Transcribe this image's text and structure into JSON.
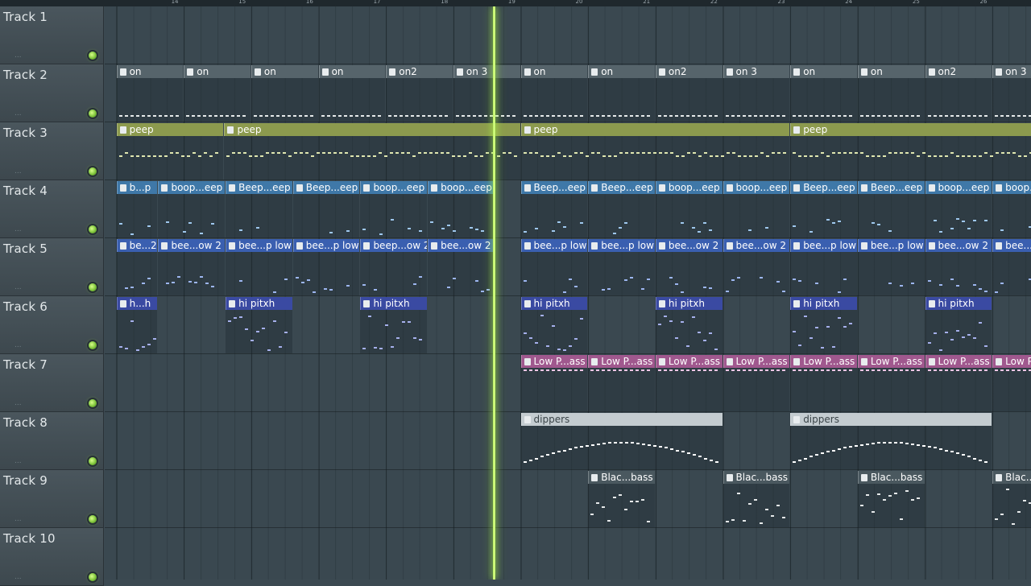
{
  "ruler": {
    "bar_numbers": [
      "14",
      "15",
      "16",
      "17",
      "18",
      "19",
      "20",
      "21",
      "22",
      "23",
      "24",
      "25",
      "26"
    ]
  },
  "tracks": [
    {
      "name": "Track 1",
      "dots": "..."
    },
    {
      "name": "Track 2",
      "dots": "..."
    },
    {
      "name": "Track 3",
      "dots": "..."
    },
    {
      "name": "Track 4",
      "dots": "..."
    },
    {
      "name": "Track 5",
      "dots": "..."
    },
    {
      "name": "Track 6",
      "dots": "..."
    },
    {
      "name": "Track 7",
      "dots": "..."
    },
    {
      "name": "Track 8",
      "dots": "..."
    },
    {
      "name": "Track 9",
      "dots": "..."
    },
    {
      "name": "Track 10",
      "dots": "..."
    }
  ],
  "clips": [
    {
      "track": 1,
      "start": 0,
      "len": 1,
      "label": "on",
      "head": "#56646b",
      "note": "#e6e9ea"
    },
    {
      "track": 1,
      "start": 1,
      "len": 1,
      "label": "on",
      "head": "#56646b",
      "note": "#e6e9ea"
    },
    {
      "track": 1,
      "start": 2,
      "len": 1,
      "label": "on",
      "head": "#56646b",
      "note": "#e6e9ea"
    },
    {
      "track": 1,
      "start": 3,
      "len": 1,
      "label": "on",
      "head": "#56646b",
      "note": "#e6e9ea"
    },
    {
      "track": 1,
      "start": 4,
      "len": 1,
      "label": "on2",
      "head": "#56646b",
      "note": "#e6e9ea"
    },
    {
      "track": 1,
      "start": 5,
      "len": 1,
      "label": "on 3",
      "head": "#56646b",
      "note": "#e6e9ea"
    },
    {
      "track": 1,
      "start": 6,
      "len": 1,
      "label": "on",
      "head": "#56646b",
      "note": "#e6e9ea"
    },
    {
      "track": 1,
      "start": 7,
      "len": 1,
      "label": "on",
      "head": "#56646b",
      "note": "#e6e9ea"
    },
    {
      "track": 1,
      "start": 8,
      "len": 1,
      "label": "on2",
      "head": "#56646b",
      "note": "#e6e9ea"
    },
    {
      "track": 1,
      "start": 9,
      "len": 1,
      "label": "on 3",
      "head": "#56646b",
      "note": "#e6e9ea"
    },
    {
      "track": 1,
      "start": 10,
      "len": 1,
      "label": "on",
      "head": "#56646b",
      "note": "#e6e9ea"
    },
    {
      "track": 1,
      "start": 11,
      "len": 1,
      "label": "on",
      "head": "#56646b",
      "note": "#e6e9ea"
    },
    {
      "track": 1,
      "start": 12,
      "len": 1,
      "label": "on2",
      "head": "#56646b",
      "note": "#e6e9ea"
    },
    {
      "track": 1,
      "start": 13,
      "len": 1,
      "label": "on 3",
      "head": "#56646b",
      "note": "#e6e9ea"
    },
    {
      "track": 2,
      "start": 0,
      "len": 1.6,
      "label": "peep",
      "head": "#8c9a4e",
      "note": "#dfe6b0"
    },
    {
      "track": 2,
      "start": 1.6,
      "len": 4.4,
      "label": "peep",
      "head": "#8c9a4e",
      "note": "#dfe6b0"
    },
    {
      "track": 2,
      "start": 6,
      "len": 4,
      "label": "peep",
      "head": "#8c9a4e",
      "note": "#dfe6b0"
    },
    {
      "track": 2,
      "start": 10,
      "len": 4,
      "label": "peep",
      "head": "#8c9a4e",
      "note": "#dfe6b0"
    },
    {
      "track": 3,
      "start": 0,
      "len": 0.62,
      "label": "b...p",
      "head": "#3f78a8",
      "note": "#9fc8ee"
    },
    {
      "track": 3,
      "start": 0.62,
      "len": 1,
      "label": "boop...eep",
      "head": "#3f78a8",
      "note": "#9fc8ee"
    },
    {
      "track": 3,
      "start": 1.62,
      "len": 1,
      "label": "Beep...eep",
      "head": "#3f78a8",
      "note": "#9fc8ee"
    },
    {
      "track": 3,
      "start": 2.62,
      "len": 1,
      "label": "Beep...eep",
      "head": "#3f78a8",
      "note": "#9fc8ee"
    },
    {
      "track": 3,
      "start": 3.62,
      "len": 1,
      "label": "boop...eep",
      "head": "#3f78a8",
      "note": "#9fc8ee"
    },
    {
      "track": 3,
      "start": 4.62,
      "len": 1,
      "label": "boop...eep",
      "head": "#3f78a8",
      "note": "#9fc8ee"
    },
    {
      "track": 3,
      "start": 6,
      "len": 1,
      "label": "Beep...eep",
      "head": "#3f78a8",
      "note": "#9fc8ee"
    },
    {
      "track": 3,
      "start": 7,
      "len": 1,
      "label": "Beep...eep",
      "head": "#3f78a8",
      "note": "#9fc8ee"
    },
    {
      "track": 3,
      "start": 8,
      "len": 1,
      "label": "boop...eep",
      "head": "#3f78a8",
      "note": "#9fc8ee"
    },
    {
      "track": 3,
      "start": 9,
      "len": 1,
      "label": "boop...eep",
      "head": "#3f78a8",
      "note": "#9fc8ee"
    },
    {
      "track": 3,
      "start": 10,
      "len": 1,
      "label": "Beep...eep",
      "head": "#3f78a8",
      "note": "#9fc8ee"
    },
    {
      "track": 3,
      "start": 11,
      "len": 1,
      "label": "Beep...eep",
      "head": "#3f78a8",
      "note": "#9fc8ee"
    },
    {
      "track": 3,
      "start": 12,
      "len": 1,
      "label": "boop...eep",
      "head": "#3f78a8",
      "note": "#9fc8ee"
    },
    {
      "track": 3,
      "start": 13,
      "len": 1,
      "label": "boop...eep",
      "head": "#3f78a8",
      "note": "#9fc8ee"
    },
    {
      "track": 4,
      "start": 0,
      "len": 0.62,
      "label": "be...2",
      "head": "#3a5fb0",
      "note": "#9db6f0"
    },
    {
      "track": 4,
      "start": 0.62,
      "len": 1,
      "label": "bee...ow 2",
      "head": "#3a5fb0",
      "note": "#9db6f0"
    },
    {
      "track": 4,
      "start": 1.62,
      "len": 1,
      "label": "bee...p low",
      "head": "#3a5fb0",
      "note": "#9db6f0"
    },
    {
      "track": 4,
      "start": 2.62,
      "len": 1,
      "label": "bee...p low",
      "head": "#3a5fb0",
      "note": "#9db6f0"
    },
    {
      "track": 4,
      "start": 3.62,
      "len": 1,
      "label": "beep...ow 2",
      "head": "#3a5fb0",
      "note": "#9db6f0"
    },
    {
      "track": 4,
      "start": 4.62,
      "len": 1,
      "label": "bee...ow 2",
      "head": "#3a5fb0",
      "note": "#9db6f0"
    },
    {
      "track": 4,
      "start": 6,
      "len": 1,
      "label": "bee...p low",
      "head": "#3a5fb0",
      "note": "#9db6f0"
    },
    {
      "track": 4,
      "start": 7,
      "len": 1,
      "label": "bee...p low",
      "head": "#3a5fb0",
      "note": "#9db6f0"
    },
    {
      "track": 4,
      "start": 8,
      "len": 1,
      "label": "bee...ow 2",
      "head": "#3a5fb0",
      "note": "#9db6f0"
    },
    {
      "track": 4,
      "start": 9,
      "len": 1,
      "label": "bee...ow 2",
      "head": "#3a5fb0",
      "note": "#9db6f0"
    },
    {
      "track": 4,
      "start": 10,
      "len": 1,
      "label": "bee...p low",
      "head": "#3a5fb0",
      "note": "#9db6f0"
    },
    {
      "track": 4,
      "start": 11,
      "len": 1,
      "label": "bee...p low",
      "head": "#3a5fb0",
      "note": "#9db6f0"
    },
    {
      "track": 4,
      "start": 12,
      "len": 1,
      "label": "bee...ow 2",
      "head": "#3a5fb0",
      "note": "#9db6f0"
    },
    {
      "track": 4,
      "start": 13,
      "len": 1,
      "label": "bee...ow 2",
      "head": "#3a5fb0",
      "note": "#9db6f0"
    },
    {
      "track": 5,
      "start": 0,
      "len": 0.62,
      "label": "h...h",
      "head": "#3a4aa2",
      "note": "#a6b0ec"
    },
    {
      "track": 5,
      "start": 1.62,
      "len": 1,
      "label": "hi pitxh",
      "head": "#3a4aa2",
      "note": "#a6b0ec"
    },
    {
      "track": 5,
      "start": 3.62,
      "len": 1,
      "label": "hi pitxh",
      "head": "#3a4aa2",
      "note": "#a6b0ec"
    },
    {
      "track": 5,
      "start": 6,
      "len": 1,
      "label": "hi pitxh",
      "head": "#3a4aa2",
      "note": "#a6b0ec"
    },
    {
      "track": 5,
      "start": 8,
      "len": 1,
      "label": "hi pitxh",
      "head": "#3a4aa2",
      "note": "#a6b0ec"
    },
    {
      "track": 5,
      "start": 10,
      "len": 1,
      "label": "hi pitxh",
      "head": "#3a4aa2",
      "note": "#a6b0ec"
    },
    {
      "track": 5,
      "start": 12,
      "len": 1,
      "label": "hi pitxh",
      "head": "#3a4aa2",
      "note": "#a6b0ec"
    },
    {
      "track": 6,
      "start": 6,
      "len": 1,
      "label": "Low P...ass",
      "head": "#a0588e",
      "note": "#f0c6e6"
    },
    {
      "track": 6,
      "start": 7,
      "len": 1,
      "label": "Low P...ass",
      "head": "#a0588e",
      "note": "#f0c6e6"
    },
    {
      "track": 6,
      "start": 8,
      "len": 1,
      "label": "Low P...ass",
      "head": "#a0588e",
      "note": "#f0c6e6"
    },
    {
      "track": 6,
      "start": 9,
      "len": 1,
      "label": "Low P...ass",
      "head": "#a0588e",
      "note": "#f0c6e6"
    },
    {
      "track": 6,
      "start": 10,
      "len": 1,
      "label": "Low P...ass",
      "head": "#a0588e",
      "note": "#f0c6e6"
    },
    {
      "track": 6,
      "start": 11,
      "len": 1,
      "label": "Low P...ass",
      "head": "#a0588e",
      "note": "#f0c6e6"
    },
    {
      "track": 6,
      "start": 12,
      "len": 1,
      "label": "Low P...ass",
      "head": "#a0588e",
      "note": "#f0c6e6"
    },
    {
      "track": 6,
      "start": 13,
      "len": 1,
      "label": "Low P...ass",
      "head": "#a0588e",
      "note": "#f0c6e6"
    },
    {
      "track": 7,
      "start": 6,
      "len": 3,
      "label": "dippers",
      "head": "#c4ccd0",
      "note": "#ffffff",
      "dark": true
    },
    {
      "track": 7,
      "start": 10,
      "len": 3,
      "label": "dippers",
      "head": "#c4ccd0",
      "note": "#ffffff",
      "dark": true
    },
    {
      "track": 8,
      "start": 7,
      "len": 1,
      "label": "Blac...bass",
      "head": "#4a585f",
      "note": "#e6e9ea"
    },
    {
      "track": 8,
      "start": 9,
      "len": 1,
      "label": "Blac...bass",
      "head": "#4a585f",
      "note": "#e6e9ea"
    },
    {
      "track": 8,
      "start": 11,
      "len": 1,
      "label": "Blac...bass",
      "head": "#4a585f",
      "note": "#e6e9ea"
    },
    {
      "track": 8,
      "start": 13,
      "len": 1,
      "label": "Blac...bass",
      "head": "#4a585f",
      "note": "#e6e9ea"
    }
  ]
}
